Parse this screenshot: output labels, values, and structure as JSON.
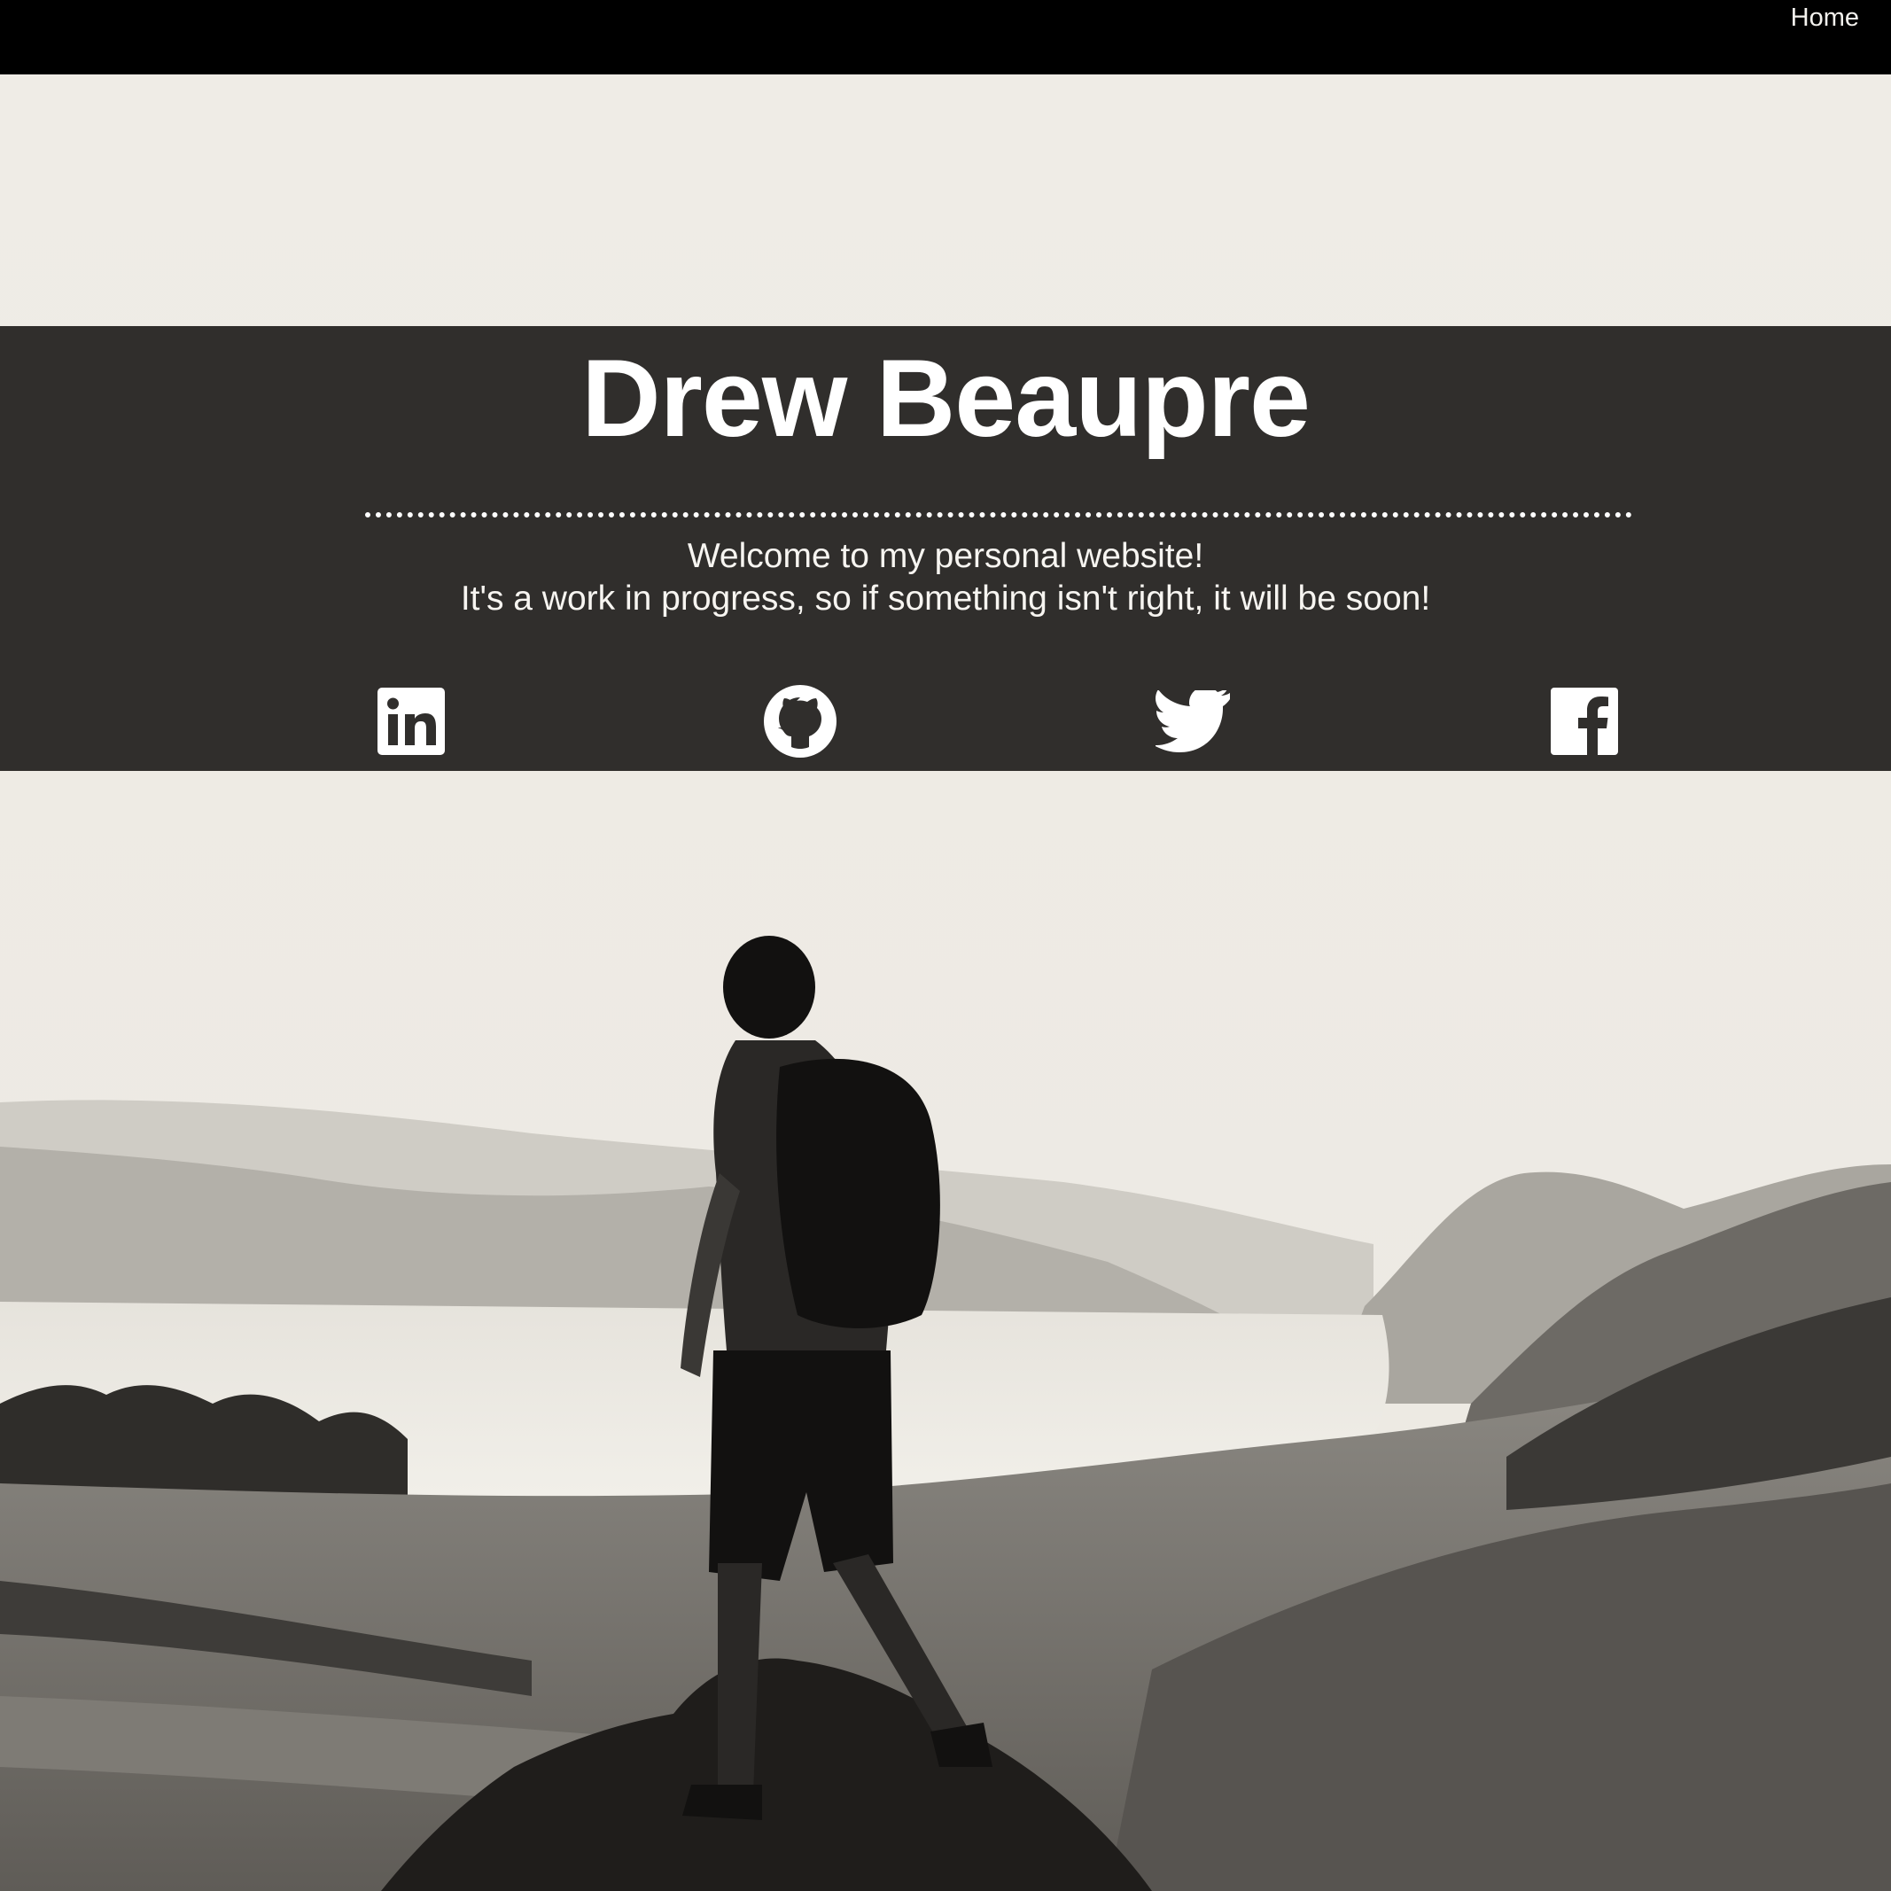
{
  "nav": {
    "home_label": "Home"
  },
  "hero": {
    "title": "Drew Beaupre",
    "welcome_line_1": "Welcome to my personal website!",
    "welcome_line_2": "It's a work in progress, so if something isn't right, it will be soon!"
  },
  "social_links": [
    {
      "icon": "linkedin-icon"
    },
    {
      "icon": "github-icon"
    },
    {
      "icon": "twitter-icon"
    },
    {
      "icon": "facebook-icon"
    }
  ],
  "colors": {
    "topbar": "#000000",
    "banner": "#302e2c",
    "sky": "#efece6",
    "text": "#ffffff"
  }
}
